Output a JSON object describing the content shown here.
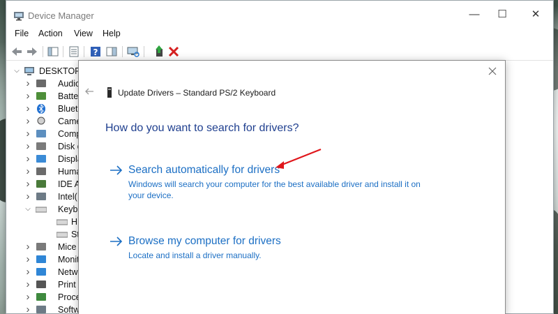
{
  "window": {
    "title": "Device Manager",
    "minimize": "—",
    "maximize": "☐",
    "close": "✕"
  },
  "menu": [
    "File",
    "Action",
    "View",
    "Help"
  ],
  "toolbar": {
    "buttons": [
      "back-icon",
      "forward-icon",
      "show-hide-console-tree-icon",
      "properties-icon",
      "help-icon",
      "action-pane-icon",
      "scan-hardware-changes-icon",
      "update-driver-icon",
      "uninstall-device-icon"
    ]
  },
  "tree": {
    "root": "DESKTOP",
    "items": [
      {
        "label": "Audio",
        "icon": "audio-icon"
      },
      {
        "label": "Batter",
        "icon": "battery-icon"
      },
      {
        "label": "Blueto",
        "icon": "bluetooth-icon"
      },
      {
        "label": "Came",
        "icon": "camera-icon"
      },
      {
        "label": "Comp",
        "icon": "computer-icon"
      },
      {
        "label": "Disk d",
        "icon": "disk-drive-icon"
      },
      {
        "label": "Displa",
        "icon": "display-adapter-icon"
      },
      {
        "label": "Huma",
        "icon": "human-interface-icon"
      },
      {
        "label": "IDE AT",
        "icon": "ide-controller-icon"
      },
      {
        "label": "Intel(",
        "icon": "intel-device-icon"
      },
      {
        "label": "Keybo",
        "icon": "keyboard-icon",
        "expanded": true
      },
      {
        "label": "H",
        "icon": "keyboard-icon",
        "child": true
      },
      {
        "label": "St",
        "icon": "keyboard-icon",
        "child": true
      },
      {
        "label": "Mice",
        "icon": "mouse-icon"
      },
      {
        "label": "Monit",
        "icon": "monitor-icon"
      },
      {
        "label": "Netw",
        "icon": "network-adapter-icon"
      },
      {
        "label": "Print",
        "icon": "print-queue-icon"
      },
      {
        "label": "Proce",
        "icon": "processor-icon"
      },
      {
        "label": "Softw",
        "icon": "software-device-icon"
      }
    ]
  },
  "dialog": {
    "title": "Update Drivers – Standard PS/2 Keyboard",
    "question": "How do you want to search for drivers?",
    "options": [
      {
        "title": "Search automatically for drivers",
        "description": "Windows will search your computer for the best available driver and install it on your device."
      },
      {
        "title": "Browse my computer for drivers",
        "description": "Locate and install a driver manually."
      }
    ]
  },
  "colors": {
    "link_blue": "#1c6fc4",
    "heading_blue": "#1f3f8f",
    "annotation_red": "#e0161b",
    "uninstall_red": "#d61f1f"
  }
}
